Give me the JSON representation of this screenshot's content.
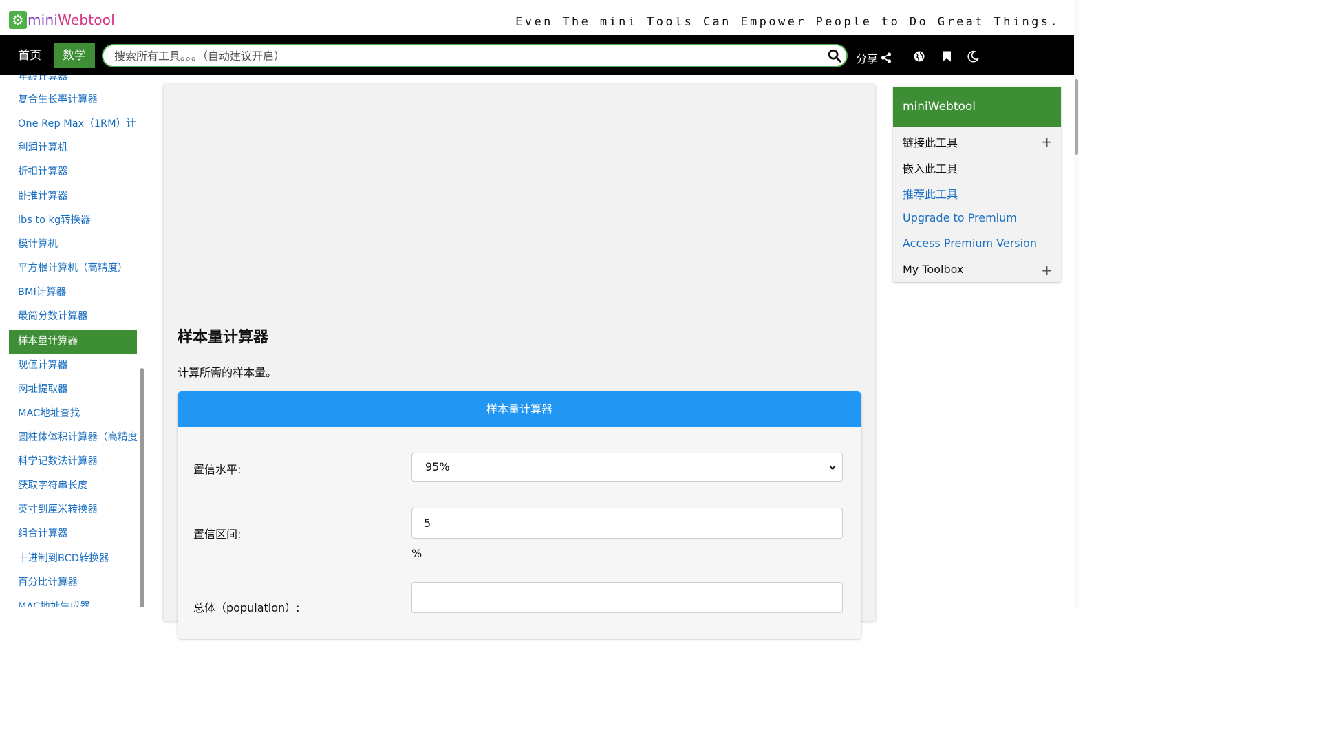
{
  "header": {
    "logo_mini": "mini",
    "logo_web": "Webtool",
    "tagline": "Even The mini Tools Can Empower People to Do Great Things."
  },
  "nav": {
    "home": "首页",
    "math": "数学",
    "search_placeholder": "搜索所有工具。。。（自动建议开启）",
    "share": "分享"
  },
  "sidebar": {
    "items": [
      "年龄计算器",
      "复合生长率计算器",
      "One Rep Max（1RM）计",
      "利润计算机",
      "折扣计算器",
      "卧推计算器",
      "lbs to kg转换器",
      "模计算机",
      "平方根计算机（高精度）",
      "BMI计算器",
      "最简分数计算器",
      "样本量计算器",
      "现值计算器",
      "网址提取器",
      "MAC地址查找",
      "圆柱体体积计算器（高精度",
      "科学记数法计算器",
      "获取字符串长度",
      "英寸到厘米转换器",
      "组合计算器",
      "十进制到BCD转换器",
      "百分比计算器",
      "MAC地址生成器"
    ],
    "active_index": 11
  },
  "main": {
    "title": "样本量计算器",
    "description": "计算所需的样本量。",
    "card_title": "样本量计算器",
    "confidence_level_label": "置信水平:",
    "confidence_level_value": "95%",
    "confidence_interval_label": "置信区间:",
    "confidence_interval_value": "5",
    "confidence_interval_unit": "%",
    "population_label": "总体（population）:",
    "population_value": ""
  },
  "right_panel": {
    "title": "miniWebtool",
    "link_tool": "链接此工具",
    "embed_tool": "嵌入此工具",
    "recommend_tool": "推荐此工具",
    "upgrade": "Upgrade to Premium",
    "access_premium": "Access Premium Version",
    "toolbox": "My Toolbox",
    "plus": "+"
  },
  "colors": {
    "brand_green": "#3e8e35",
    "card_blue": "#2196f3",
    "link_blue": "#1a6fc2"
  }
}
